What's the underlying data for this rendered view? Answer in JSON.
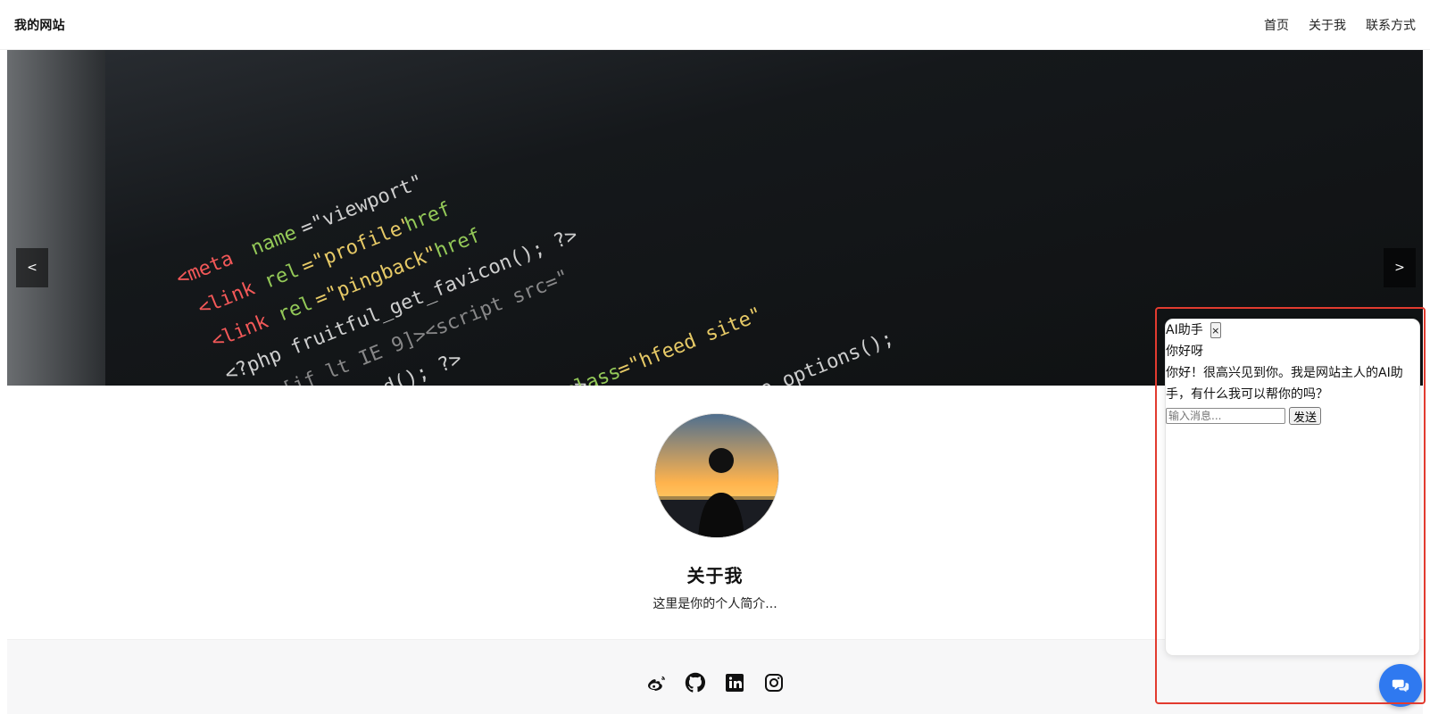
{
  "header": {
    "brand": "我的网站",
    "nav": [
      "首页",
      "关于我",
      "联系方式"
    ]
  },
  "carousel": {
    "prev_label": "<",
    "next_label": ">"
  },
  "about": {
    "title": "关于我",
    "intro": "这里是你的个人简介..."
  },
  "footer": {
    "icons": [
      "weibo-icon",
      "github-icon",
      "linkedin-icon",
      "instagram-icon"
    ]
  },
  "chat": {
    "title": "AI助手",
    "close_label": "×",
    "messages": [
      "你好呀",
      "你好！很高兴见到你。我是网站主人的AI助手，有什么我可以帮你的吗？"
    ],
    "input_placeholder": "输入消息...",
    "send_label": "发送"
  },
  "colors": {
    "accent": "#2f79f0",
    "highlight": "#e23b2f"
  }
}
